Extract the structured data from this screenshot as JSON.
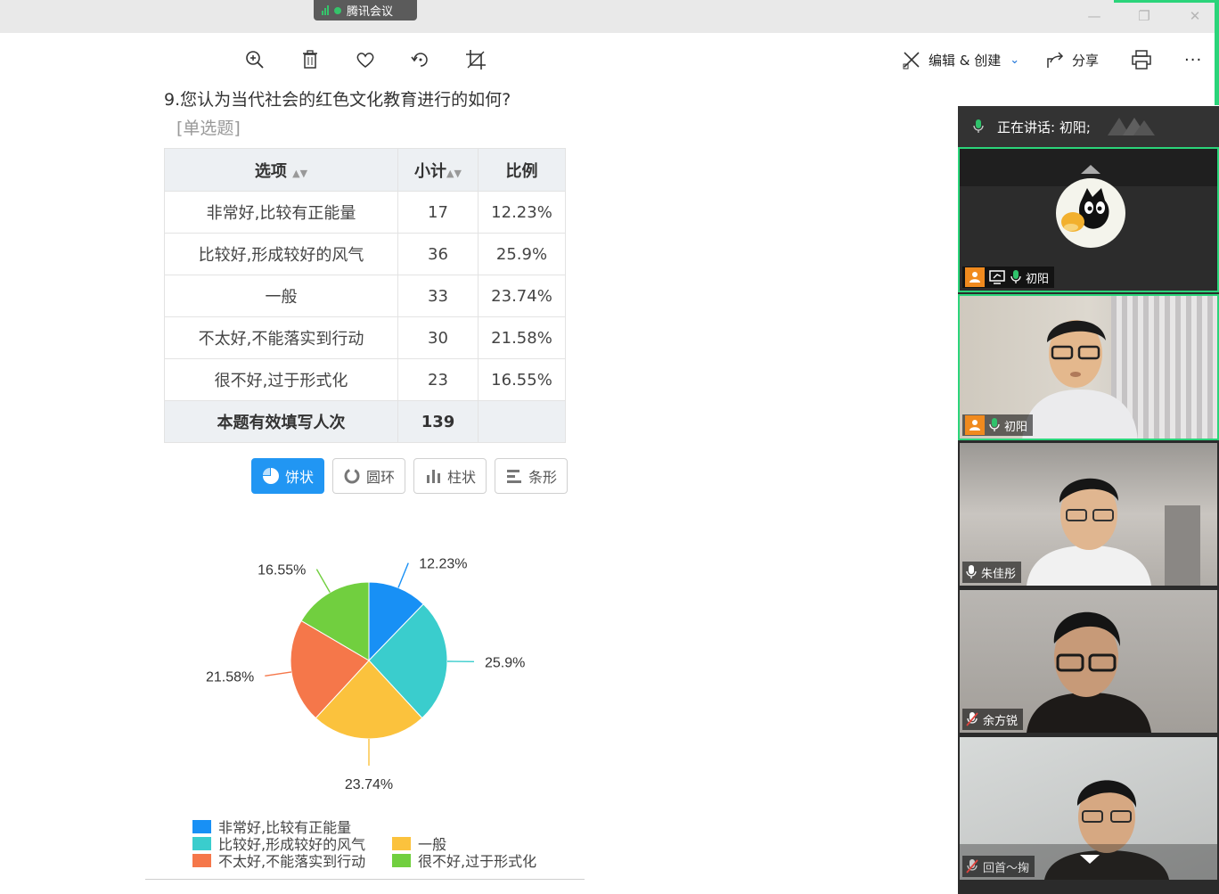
{
  "app": {
    "meeting_title": "腾讯会议"
  },
  "toolbar": {
    "edit_create_label": "编辑 & 创建",
    "share_label": "分享",
    "more_label": "···"
  },
  "survey": {
    "question": "9.您认为当代社会的红色文化教育进行的如何?",
    "question_type": "[单选题]",
    "table": {
      "headers": [
        "选项",
        "小计",
        "比例"
      ],
      "rows": [
        {
          "option": "非常好,比较有正能量",
          "count": "17",
          "ratio": "12.23%"
        },
        {
          "option": "比较好,形成较好的风气",
          "count": "36",
          "ratio": "25.9%"
        },
        {
          "option": "一般",
          "count": "33",
          "ratio": "23.74%"
        },
        {
          "option": "不太好,不能落实到行动",
          "count": "30",
          "ratio": "21.58%"
        },
        {
          "option": "很不好,过于形式化",
          "count": "23",
          "ratio": "16.55%"
        }
      ],
      "total_label": "本题有效填写人次",
      "total_count": "139"
    },
    "chart_buttons": [
      "饼状",
      "圆环",
      "柱状",
      "条形"
    ]
  },
  "chart_data": {
    "type": "pie",
    "categories": [
      "非常好,比较有正能量",
      "比较好,形成较好的风气",
      "一般",
      "不太好,不能落实到行动",
      "很不好,过于形式化"
    ],
    "values": [
      12.23,
      25.9,
      23.74,
      21.58,
      16.55
    ],
    "labels": [
      "12.23%",
      "25.9%",
      "23.74%",
      "21.58%",
      "16.55%"
    ],
    "colors": [
      "#1890f5",
      "#3acdcd",
      "#fbc23d",
      "#f5774a",
      "#71cf3f"
    ],
    "legend_position": "bottom"
  },
  "meeting_panel": {
    "speaking_text": "正在讲话: 初阳;",
    "participants": [
      {
        "name": "初阳",
        "video": false
      },
      {
        "name": "初阳",
        "video": true
      },
      {
        "name": "朱佳彤",
        "video": true
      },
      {
        "name": "余方锐",
        "video": true,
        "muted": true
      },
      {
        "name": "回首～掬",
        "video": true,
        "muted": true
      }
    ]
  }
}
